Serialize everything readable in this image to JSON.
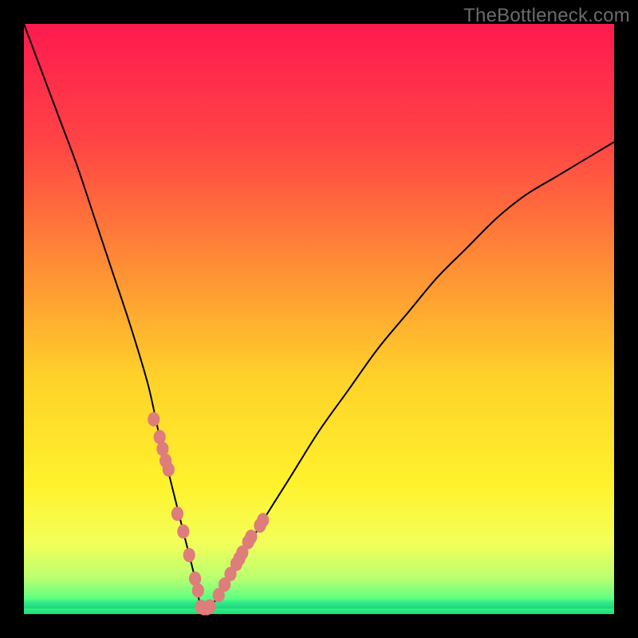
{
  "watermark": "TheBottleneck.com",
  "colors": {
    "gradient_stops": [
      {
        "pct": 0,
        "hex": "#ff1a4f"
      },
      {
        "pct": 20,
        "hex": "#ff4445"
      },
      {
        "pct": 40,
        "hex": "#ff8a36"
      },
      {
        "pct": 60,
        "hex": "#ffd22a"
      },
      {
        "pct": 78,
        "hex": "#fff22c"
      },
      {
        "pct": 88,
        "hex": "#f3ff5a"
      },
      {
        "pct": 94,
        "hex": "#b8ff70"
      },
      {
        "pct": 98,
        "hex": "#4cff86"
      },
      {
        "pct": 100,
        "hex": "#18e079"
      }
    ],
    "dot_fill": "#de7d7b",
    "curve_stroke": "#000000",
    "page_border": "#000000"
  },
  "chart_data": {
    "type": "line",
    "title": "",
    "xlabel": "",
    "ylabel": "",
    "xlim": [
      0,
      100
    ],
    "ylim": [
      0,
      100
    ],
    "description": "V-shaped bottleneck curve: steep left branch descending to near-zero around x≈30, then rising with decreasing slope on the right branch; background is a vertical readiness gradient (red=high bottleneck % at top, green=low at bottom). Salmon dots mark sampled configurations clustered around the valley.",
    "series": [
      {
        "name": "bottleneck_percent",
        "x": [
          0,
          3,
          6,
          9,
          12,
          15,
          18,
          21,
          23,
          25,
          27,
          29,
          30,
          31,
          33,
          36,
          40,
          45,
          50,
          55,
          60,
          65,
          70,
          75,
          80,
          85,
          90,
          95,
          100
        ],
        "y": [
          100,
          92,
          84,
          76,
          67,
          58,
          49,
          39,
          30,
          22,
          14,
          6,
          1,
          1,
          3,
          8,
          15,
          23,
          31,
          38,
          45,
          51,
          57,
          62,
          67,
          71,
          74,
          77,
          80
        ]
      },
      {
        "name": "sample_dots",
        "x": [
          22,
          23,
          23.5,
          24,
          24.5,
          26,
          27,
          28,
          29,
          29.5,
          30,
          30.5,
          31,
          31.5,
          33,
          34,
          35,
          36,
          36.5,
          37,
          38,
          38.5,
          40,
          40.5
        ],
        "y": [
          33,
          30,
          28,
          26,
          24.5,
          17,
          14,
          10,
          6,
          4,
          1.2,
          1.0,
          1.0,
          1.3,
          3.2,
          5.0,
          6.8,
          8.5,
          9.4,
          10.4,
          12.2,
          13.1,
          15.0,
          15.9
        ]
      }
    ],
    "green_band_y_pct": 98.5,
    "dot_radius_px": 9
  }
}
